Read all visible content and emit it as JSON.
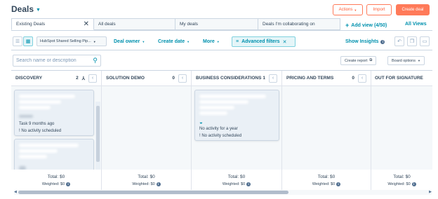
{
  "header": {
    "title": "Deals",
    "actions_label": "Actions",
    "import_label": "Import",
    "create_label": "Create deal"
  },
  "tabs": [
    {
      "label": "Existing Deals"
    },
    {
      "label": "All deals"
    },
    {
      "label": "My deals"
    },
    {
      "label": "Deals I'm collaborating on"
    }
  ],
  "tab_actions": {
    "add_view": "Add view (4/50)",
    "all_views": "All Views"
  },
  "filters": {
    "pipeline": "HubSpot Shared Selling Pip...",
    "deal_owner": "Deal owner",
    "create_date": "Create date",
    "more": "More",
    "advanced": "Advanced filters",
    "show_insights": "Show Insights"
  },
  "search": {
    "placeholder": "Search name or description"
  },
  "board_actions": {
    "create_report": "Create report",
    "board_options": "Board options"
  },
  "columns": [
    {
      "name": "DISCOVERY",
      "count": "2",
      "total": "Total: $0",
      "weighted": "Weighted: $0"
    },
    {
      "name": "SOLUTION DEMO",
      "count": "0",
      "total": "Total: $0",
      "weighted": "Weighted: $0"
    },
    {
      "name": "BUSINESS CONSIDERATIONS",
      "count": "1",
      "total": "Total: $0",
      "weighted": "Weighted: $0"
    },
    {
      "name": "PRICING AND TERMS",
      "count": "0",
      "total": "Total: $0",
      "weighted": "Weighted: $0"
    },
    {
      "name": "OUT FOR SIGNATURE",
      "count": "",
      "total": "Total: $0",
      "weighted": "Weighted: $0"
    }
  ],
  "cards": {
    "discovery_1": {
      "task": "Task 9 months ago",
      "activity": "No activity scheduled"
    },
    "business_1": {
      "status": "No activity for a year",
      "activity": "No activity scheduled"
    }
  },
  "colors": {
    "accent": "#ff7a59",
    "link": "#0091ae",
    "text": "#33475b",
    "border": "#cbd6e2"
  }
}
